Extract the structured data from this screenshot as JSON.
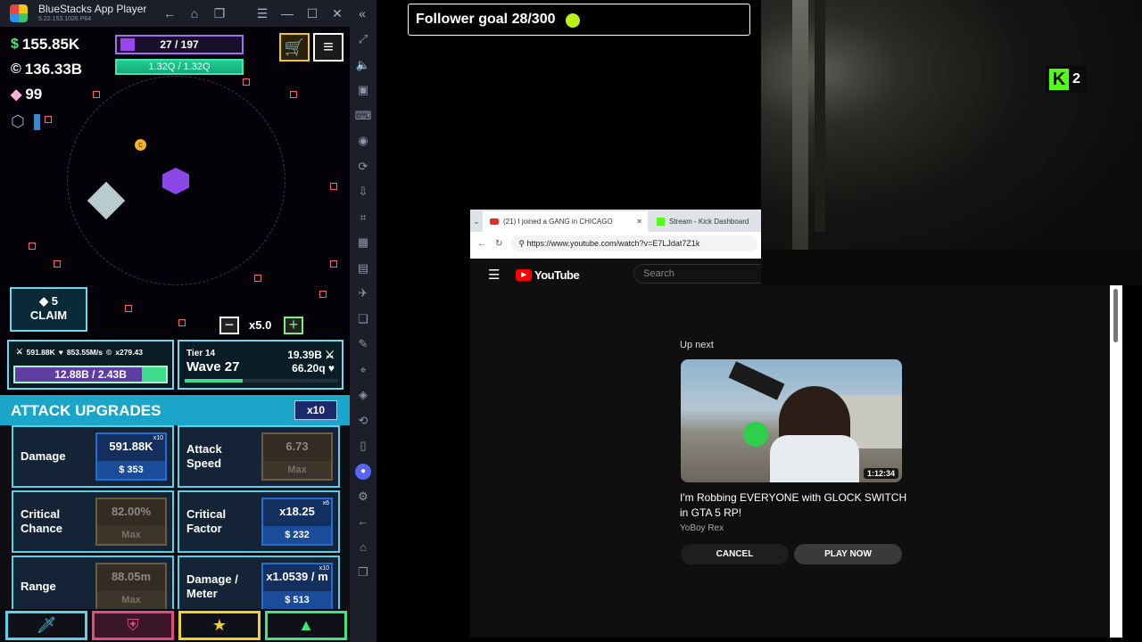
{
  "bluestacks": {
    "title": "BlueStacks App Player",
    "version": "5.22.153.1026  P64",
    "toolbar_icons": [
      "back-icon",
      "home-icon",
      "recent-apps-icon"
    ],
    "window_controls": [
      "menu-icon",
      "minimize-icon",
      "maximize-icon",
      "close-icon",
      "collapse-sidebar-icon"
    ],
    "sidebar_icons": [
      "fullscreen-icon",
      "volume-icon",
      "media-icon",
      "keyboard-icon",
      "record-icon",
      "rotate-icon",
      "install-apk-icon",
      "screenshot-icon",
      "macro-icon",
      "folder-icon",
      "airplane-icon",
      "multi-instance-icon",
      "eco-mode-icon",
      "location-icon",
      "layers-icon",
      "sync-icon",
      "sidebar-icon",
      "discord-icon",
      "settings-icon",
      "back-icon",
      "home-icon",
      "recent-icon"
    ]
  },
  "game": {
    "cash": "155.85K",
    "coins": "136.33B",
    "gems": "99",
    "purple_bar": "27 / 197",
    "green_bar": "1.32Q / 1.32Q",
    "claim": {
      "gems": "5",
      "label": "CLAIM"
    },
    "speed": "x5.0",
    "stats": {
      "damage": "591.88K",
      "rate": "853.55M/s",
      "coins_mult": "x279.43",
      "xp": "12.88B / 2.43B",
      "xp_fill": 0.84
    },
    "wave": {
      "tier": "Tier 14",
      "label": "Wave 27",
      "enemy_damage": "19.39B",
      "enemy_health": "66.20q",
      "progress": 0.38
    },
    "upgrades": {
      "title": "ATTACK UPGRADES",
      "multiplier": "x10",
      "cards": [
        {
          "name": "Damage",
          "value": "591.88K",
          "cost": "$ 353",
          "badge": "x10",
          "maxed": false
        },
        {
          "name": "Attack Speed",
          "value": "6.73",
          "cost": "Max",
          "badge": "",
          "maxed": true
        },
        {
          "name": "Critical Chance",
          "value": "82.00%",
          "cost": "Max",
          "badge": "",
          "maxed": true
        },
        {
          "name": "Critical Factor",
          "value": "x18.25",
          "cost": "$ 232",
          "badge": "x6",
          "maxed": false
        },
        {
          "name": "Range",
          "value": "88.05m",
          "cost": "Max",
          "badge": "",
          "maxed": true
        },
        {
          "name": "Damage / Meter",
          "value": "x1.0539 / m",
          "cost": "$ 513",
          "badge": "x10",
          "maxed": false
        }
      ]
    },
    "tabs": [
      {
        "icon": "sword-icon",
        "color": "#5bd1ee"
      },
      {
        "icon": "shield-icon",
        "color": "#e04b84"
      },
      {
        "icon": "star-icon",
        "color": "#f1cf2e"
      },
      {
        "icon": "triangle-icon",
        "color": "#3fe67f"
      }
    ]
  },
  "overlay": {
    "follower_goal": "Follower goal 28/300",
    "kick_viewers": "2"
  },
  "browser": {
    "tabs": [
      {
        "label": "(21) I joined a GANG in CHICAGO",
        "active": true
      },
      {
        "label": "Stream - Kick Dashboard",
        "active": false
      }
    ],
    "url": "https://www.youtube.com/watch?v=E7LJdat7Z1k",
    "youtube": {
      "logo_text": "YouTube",
      "search_placeholder": "Search",
      "up_next": "Up next",
      "duration": "1:12:34",
      "video_title": "I'm Robbing EVERYONE with GLOCK SWITCH in GTA 5 RP!",
      "channel": "YoBoy Rex",
      "cancel": "CANCEL",
      "play_now": "PLAY NOW"
    }
  }
}
